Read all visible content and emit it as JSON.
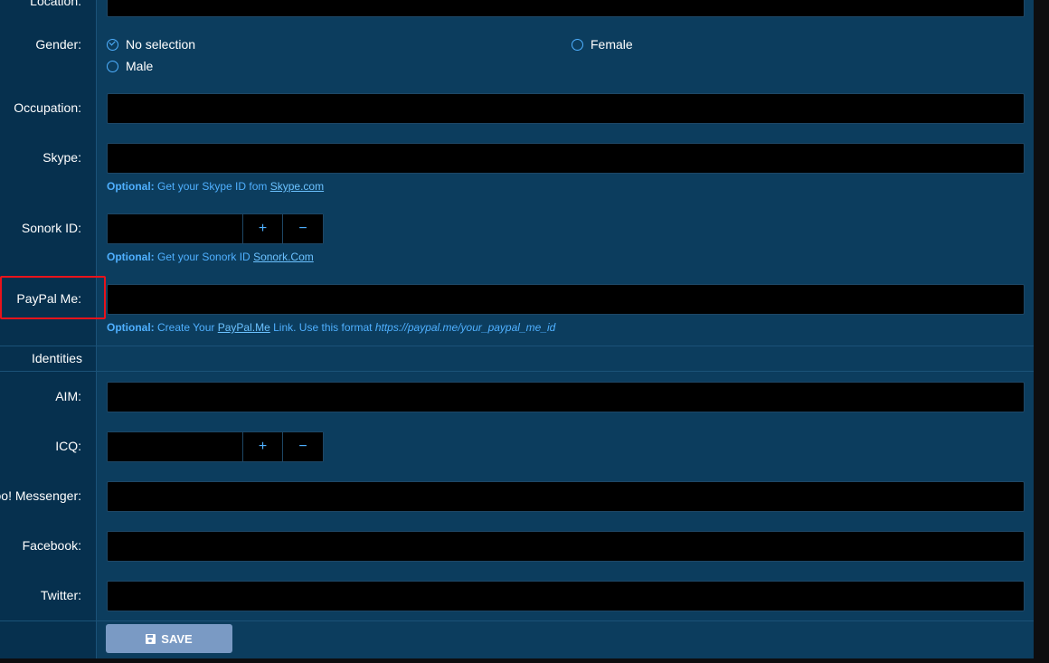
{
  "fields": {
    "location_label": "Location:",
    "gender_label": "Gender:",
    "occupation_label": "Occupation:",
    "skype_label": "Skype:",
    "sonork_label": "Sonork ID:",
    "paypal_label": "PayPal Me:",
    "aim_label": "AIM:",
    "icq_label": "ICQ:",
    "yahoo_label": "ahoo! Messenger:",
    "facebook_label": "Facebook:",
    "twitter_label": "Twitter:"
  },
  "gender": {
    "options": [
      "No selection",
      "Female",
      "Male"
    ],
    "selected": "No selection"
  },
  "hints": {
    "optional": "Optional:",
    "skype_text": "Get your Skype ID fom",
    "skype_link": "Skype.com",
    "sonork_text": "Get your Sonork ID",
    "sonork_link": "Sonork.Com",
    "paypal_text1": "Create Your",
    "paypal_link": "PayPal.Me",
    "paypal_text2": "Link. Use this format",
    "paypal_format": "https://paypal.me/your_paypal_me_id"
  },
  "spinner": {
    "plus": "+",
    "minus": "−"
  },
  "section": {
    "identities": "Identities"
  },
  "actions": {
    "save_label": "SAVE"
  },
  "colors": {
    "accent": "#4fb0ff",
    "highlight": "#e8131b",
    "panel": "#0c3d5e",
    "input_bg": "#000000"
  }
}
